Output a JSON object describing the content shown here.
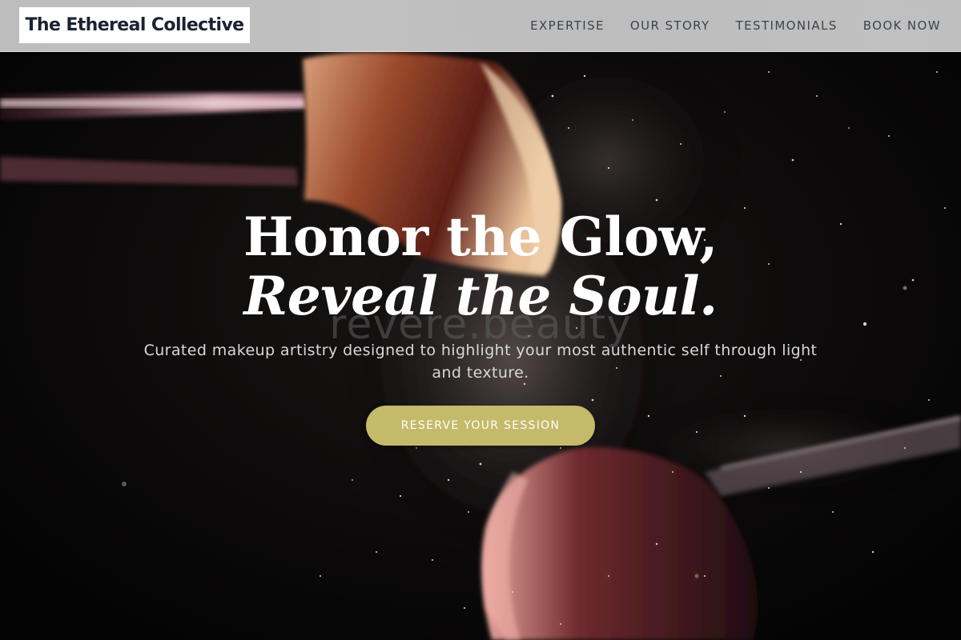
{
  "header": {
    "brand": "The Ethereal Collective",
    "nav": [
      {
        "label": "EXPERTISE"
      },
      {
        "label": "OUR STORY"
      },
      {
        "label": "TESTIMONIALS"
      },
      {
        "label": "BOOK NOW"
      }
    ]
  },
  "hero": {
    "headline_line1": "Honor the Glow,",
    "headline_line2": "Reveal the Soul.",
    "watermark": "revere.beauty",
    "subtitle": "Curated makeup artistry designed to highlight your most authentic self through light and texture.",
    "cta_label": "RESERVE YOUR SESSION",
    "background_image": "makeup-brushes-with-powder-particles"
  },
  "colors": {
    "accent": "#c4ba6a",
    "background": "#050505",
    "brand_text": "#1b2230",
    "nav_text": "#3c4450"
  }
}
